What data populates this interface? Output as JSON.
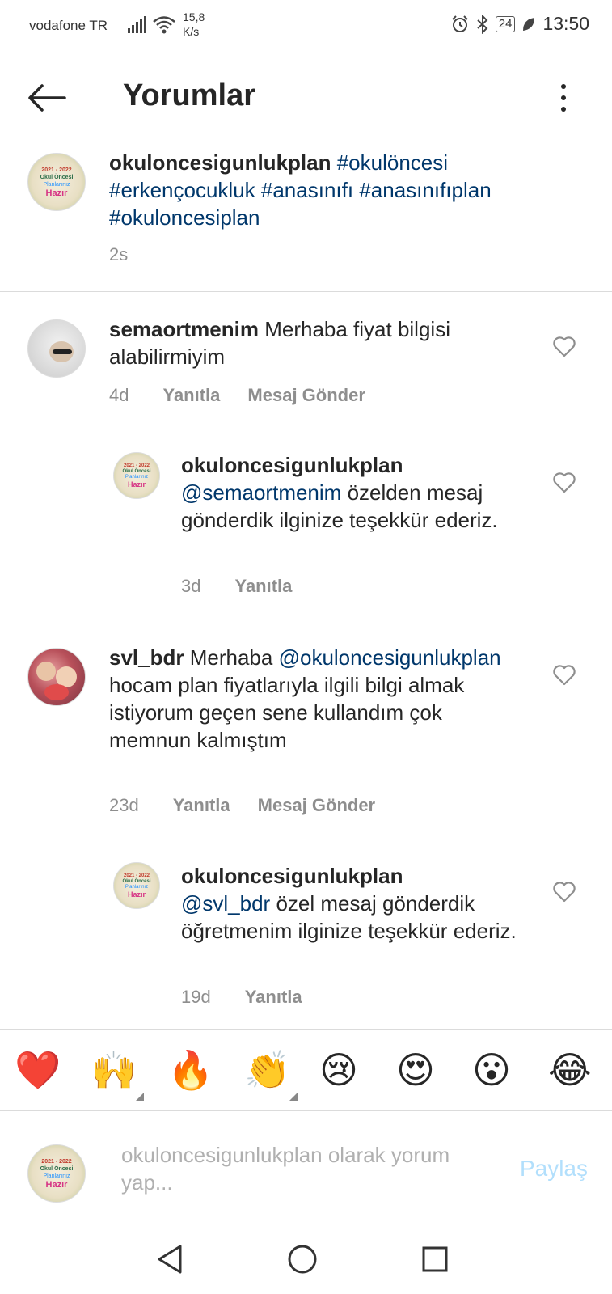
{
  "status_bar": {
    "carrier": "vodafone TR",
    "speed_value": "15,8",
    "speed_unit": "K/s",
    "battery": "24",
    "time": "13:50"
  },
  "header": {
    "title": "Yorumlar"
  },
  "caption": {
    "username": "okuloncesigunlukplan",
    "hashtags": [
      "#okulöncesi",
      "#erkençocukluk",
      "#anasınıfı",
      "#anasınıfıplan",
      "#okuloncesiplan"
    ],
    "time": "2s"
  },
  "avatar_logo": {
    "line1": "2021 - 2022",
    "line2": "Okul Öncesi",
    "line3": "Planlarınız",
    "line4": "Hazır"
  },
  "comments": [
    {
      "username": "semaortmenim",
      "text": "Merhaba fiyat bilgisi alabilirmiyim",
      "time": "4d",
      "reply_label": "Yanıtla",
      "message_label": "Mesaj Gönder"
    },
    {
      "username": "okuloncesigunlukplan",
      "mention": "@semaortmenim",
      "text": "özelden mesaj gönderdik ilginize teşekkür ederiz.",
      "time": "3d",
      "reply_label": "Yanıtla"
    },
    {
      "username": "svl_bdr",
      "text_before": "Merhaba",
      "mention": "@okuloncesigunlukplan",
      "text": "hocam plan fiyatlarıyla ilgili bilgi almak istiyorum geçen sene kullandım çok memnun kalmıştım",
      "time": "23d",
      "reply_label": "Yanıtla",
      "message_label": "Mesaj Gönder"
    },
    {
      "username": "okuloncesigunlukplan",
      "mention": "@svl_bdr",
      "text": "özel mesaj gönderdik öğretmenim ilginize teşekkür ederiz.",
      "time": "19d",
      "reply_label": "Yanıtla"
    }
  ],
  "emoji_bar": [
    "❤️",
    "🙌",
    "🔥",
    "👏",
    "😢",
    "😍",
    "😮",
    "😂"
  ],
  "composer": {
    "placeholder": "okuloncesigunlukplan olarak yorum yap...",
    "share_label": "Paylaş"
  },
  "icons": {
    "back": "arrow-left-icon",
    "more": "more-vertical-icon",
    "heart": "heart-outline-icon",
    "nav_back": "triangle-back-icon",
    "nav_home": "circle-home-icon",
    "nav_recents": "square-recents-icon"
  },
  "colors": {
    "mention": "#00376b",
    "meta": "#8e8e8e",
    "share_disabled": "#b2dffc"
  }
}
